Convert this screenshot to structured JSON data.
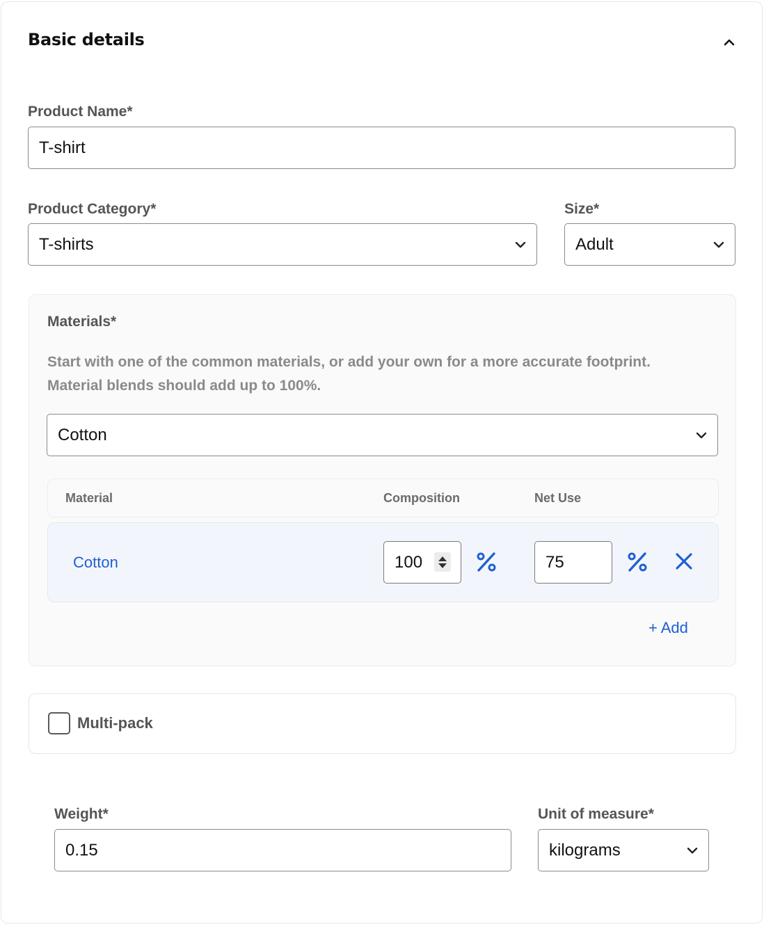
{
  "section": {
    "title": "Basic details"
  },
  "product_name": {
    "label": "Product Name*",
    "value": "T-shirt"
  },
  "product_category": {
    "label": "Product Category*",
    "value": "T-shirts"
  },
  "size": {
    "label": "Size*",
    "value": "Adult"
  },
  "materials": {
    "title": "Materials*",
    "description_line1": "Start with one of the common materials, or add your own for a more accurate footprint.",
    "description_line2": "Material blends should add up to 100%.",
    "select_value": "Cotton",
    "columns": {
      "material": "Material",
      "composition": "Composition",
      "net_use": "Net Use"
    },
    "rows": [
      {
        "material": "Cotton",
        "composition": "100",
        "net_use": "75"
      }
    ],
    "add_label": "+ Add"
  },
  "multipack": {
    "label": "Multi-pack",
    "checked": false
  },
  "weight": {
    "label": "Weight*",
    "value": "0.15"
  },
  "unit_of_measure": {
    "label": "Unit of measure*",
    "value": "kilograms"
  },
  "colors": {
    "accent": "#1f5fd1",
    "label": "#555555",
    "border": "#8a8a8a"
  }
}
